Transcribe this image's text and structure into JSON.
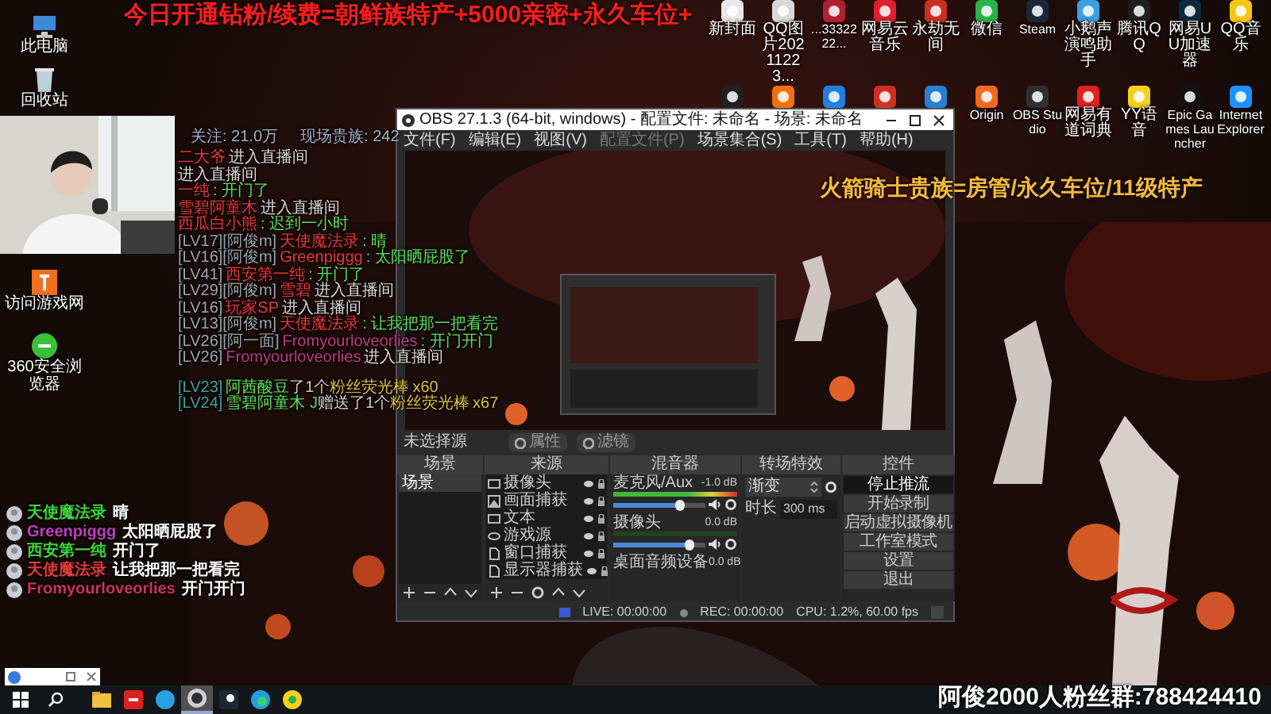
{
  "banner": "今日开通钻粉/续费=朝鲜族特产+5000亲密+永久车位+",
  "perks": "火箭骑士贵族=房管/永久车位/11级特产",
  "fan_group": "阿俊2000人粉丝群:788424410",
  "left_icons": [
    {
      "label": "此电脑"
    },
    {
      "label": "回收站"
    },
    {
      "label": "访问游戏网"
    },
    {
      "label": "360安全浏览器"
    }
  ],
  "desktop_icons": [
    {
      "kind": "app",
      "label": "新封面"
    },
    {
      "kind": "app",
      "label": "QQ图片20211223..."
    },
    {
      "kind": "app",
      "label": "...3332222..."
    },
    {
      "kind": "app",
      "label": "网易云音乐"
    },
    {
      "kind": "app",
      "label": "永劫无间"
    },
    {
      "kind": "app",
      "label": "微信"
    },
    {
      "kind": "app",
      "label": "Steam"
    },
    {
      "kind": "app",
      "label": "小鹅声演鸣助手"
    },
    {
      "kind": "app",
      "label": "腾讯QQ"
    },
    {
      "kind": "app",
      "label": "网易UU加速器"
    },
    {
      "kind": "app",
      "label": "QQ音乐"
    },
    {
      "kind": "app"
    },
    {
      "kind": "app"
    },
    {
      "kind": "app"
    },
    {
      "kind": "app"
    },
    {
      "kind": "app"
    },
    {
      "kind": "app",
      "label": "Origin"
    },
    {
      "kind": "app",
      "label": "OBS Studio"
    },
    {
      "kind": "app",
      "label": "网易有道词典"
    },
    {
      "kind": "app",
      "label": "YY语音"
    },
    {
      "kind": "app",
      "label": "Epic Games Launcher"
    },
    {
      "kind": "app",
      "label": "Internet Explorer"
    }
  ],
  "stats": [
    "关注: 21.0万",
    "现场贵族: 242"
  ],
  "chat_log": [
    {
      "kind": "enter",
      "user": "二大爷",
      "text": "进入直播间",
      "color": "#e83a3a"
    },
    {
      "kind": "enter",
      "text": "进入直播间"
    },
    {
      "kind": "message",
      "user": "一纯",
      "text": ": 开门了",
      "color": "#e83a3a"
    },
    {
      "kind": "enter",
      "user": "雪碧阿童木",
      "text": "进入直播间",
      "color": "#e83a3a"
    },
    {
      "kind": "message",
      "user": "西瓜白小熊",
      "text": ": 迟到一小时",
      "color": "#e83a3a"
    },
    {
      "kind": "message",
      "level": "[LV17][阿俊m]",
      "user": "天使魔法录",
      "text": ": 晴",
      "color": "#e83a3a"
    },
    {
      "kind": "message",
      "level": "[LV16][阿俊m]",
      "user": "Greenpiggg",
      "text": ": 太阳晒屁股了",
      "color": "#e83a3a"
    },
    {
      "kind": "message",
      "level": "[LV41]",
      "user": "西安第一纯",
      "text": ": 开门了",
      "color": "#e83a3a"
    },
    {
      "kind": "enter",
      "level": "[LV29][阿俊m]",
      "user": "雪碧",
      "text": "进入直播间",
      "color": "#e83a3a"
    },
    {
      "kind": "enter",
      "level": "[LV16]",
      "user": "玩家SP",
      "text": "进入直播间",
      "color": "#e83a3a"
    },
    {
      "kind": "message",
      "level": "[LV13][阿俊m]",
      "user": "天使魔法录",
      "text": ": 让我把那一把看完",
      "color": "#e83a3a"
    },
    {
      "kind": "message",
      "level": "[LV26][阿一面]",
      "user": "Fromyourloveorlies",
      "text": ": 开门开门",
      "color": "#c03a8a"
    },
    {
      "kind": "enter",
      "level": "[LV26]",
      "user": "Fromyourloveorlies",
      "text": "进入直播间",
      "color": "#c03a8a"
    }
  ],
  "gifts": [
    {
      "level": "[LV23]",
      "user": "阿茜酸豆",
      "text": "了1个",
      "item": "粉丝荧光棒",
      "count": "x60"
    },
    {
      "level": "[LV24]",
      "user": "雪碧阿童木 J",
      "text": "赠送了1个",
      "item": "粉丝荧光棒",
      "count": "x67"
    }
  ],
  "chat_overlay": [
    {
      "user": "天使魔法录",
      "text": "晴",
      "color": "#3ad43a"
    },
    {
      "user": "Greenpiggg",
      "text": "太阳晒屁股了",
      "color": "#c040c0"
    },
    {
      "user": "西安第一纯",
      "text": "开门了",
      "color": "#3ad43a"
    },
    {
      "user": "天使魔法录",
      "text": "让我把那一把看完",
      "color": "#e03a3a"
    },
    {
      "user": "Fromyourloveorlies",
      "text": "开门开门",
      "color": "#d03060"
    }
  ],
  "obs": {
    "title": "OBS 27.1.3 (64-bit, windows) - 配置文件: 未命名 - 场景: 未命名",
    "menu": [
      {
        "label": "文件(F)",
        "disabled": false
      },
      {
        "label": "编辑(E)",
        "disabled": false
      },
      {
        "label": "视图(V)",
        "disabled": false
      },
      {
        "label": "配置文件(P)",
        "disabled": true
      },
      {
        "label": "场景集合(S)",
        "disabled": false
      },
      {
        "label": "工具(T)",
        "disabled": false
      },
      {
        "label": "帮助(H)",
        "disabled": false
      }
    ],
    "source_bar": {
      "label": "未选择源",
      "buttons": [
        "属性",
        "滤镜"
      ]
    },
    "scenes": {
      "title": "场景",
      "items": [
        {
          "label": "场景",
          "selected": true
        }
      ]
    },
    "sources": {
      "title": "来源",
      "items": [
        {
          "label": "摄像头",
          "kind": "camera"
        },
        {
          "label": "画面捕获",
          "kind": "capture"
        },
        {
          "label": "文本",
          "kind": "camera"
        },
        {
          "label": "游戏源",
          "kind": "game"
        },
        {
          "label": "窗口捕获",
          "kind": "file"
        },
        {
          "label": "显示器捕获",
          "kind": "file"
        }
      ]
    },
    "mixer": {
      "title": "混音器",
      "channels": [
        {
          "name": "麦克风/Aux",
          "reading": "-1.0 dB",
          "active": true,
          "level": 0.72
        },
        {
          "name": "摄像头",
          "reading": "0.0 dB",
          "active": false,
          "level": 0.82
        },
        {
          "name": "桌面音频设备",
          "reading": "0.0 dB"
        }
      ]
    },
    "transitions": {
      "title": "转场特效",
      "transition": "渐变",
      "duration_label": "时长",
      "duration": "300 ms"
    },
    "controls": {
      "title": "控件",
      "buttons": [
        {
          "label": "停止推流",
          "active": true
        },
        {
          "label": "开始录制",
          "active": false
        },
        {
          "label": "启动虚拟摄像机",
          "active": false
        },
        {
          "label": "工作室模式",
          "active": false
        },
        {
          "label": "设置",
          "active": false
        },
        {
          "label": "退出",
          "active": false
        }
      ]
    },
    "status": {
      "live": "LIVE: 00:00:00",
      "rec": "REC: 00:00:00",
      "cpu": "CPU: 1.2%, 60.00 fps"
    }
  },
  "taskbar": {
    "apps": [
      {
        "kind": "folder",
        "selected": false
      },
      {
        "kind": "red-app",
        "selected": false
      },
      {
        "kind": "blue-app",
        "selected": false
      },
      {
        "kind": "obs",
        "selected": true
      },
      {
        "kind": "steam",
        "selected": false
      },
      {
        "kind": "edge",
        "selected": false
      },
      {
        "kind": "music",
        "selected": false
      }
    ]
  }
}
